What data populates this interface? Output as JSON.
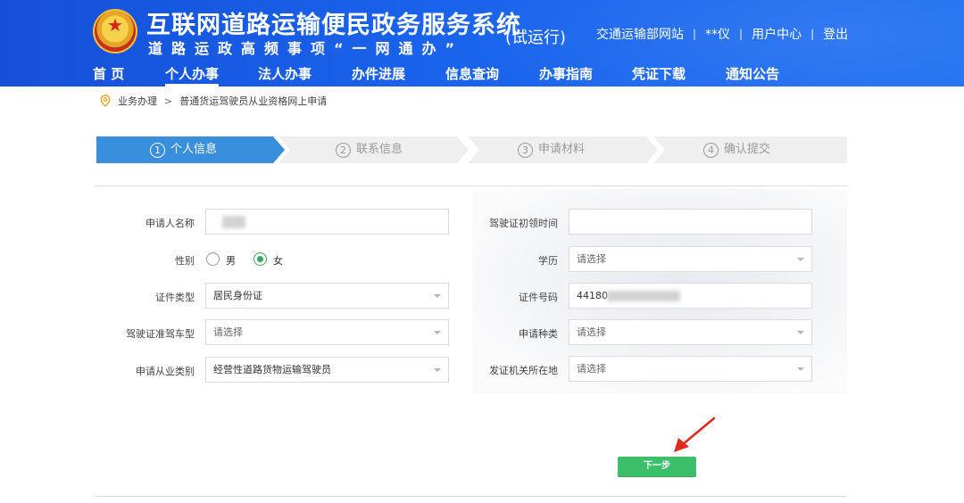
{
  "header": {
    "title": "互联网道路运输便民政务服务系统",
    "subtitle": "道路运政高频事项“一网通办”",
    "trial": "(试运行)",
    "links": [
      "交通运输部网站",
      "**仪",
      "用户中心",
      "登出"
    ],
    "separator": "|"
  },
  "nav": {
    "items": [
      "首 页",
      "个人办事",
      "法人办事",
      "办件进展",
      "信息查询",
      "办事指南",
      "凭证下载",
      "通知公告"
    ],
    "active_index": 1
  },
  "breadcrumb": {
    "items": [
      "业务办理",
      "普通货运驾驶员从业资格网上申请"
    ],
    "arrow": ">"
  },
  "steps": [
    {
      "num": "1",
      "label": "个人信息",
      "active": true
    },
    {
      "num": "2",
      "label": "联系信息",
      "active": false
    },
    {
      "num": "3",
      "label": "申请材料",
      "active": false
    },
    {
      "num": "4",
      "label": "确认提交",
      "active": false
    }
  ],
  "colors": {
    "step_active": "#3a8fdc",
    "step_inactive": "#efefef",
    "radio_on": "#38a85c",
    "button": "#3bbf6a",
    "arrow": "#e0281e"
  },
  "form": {
    "applicant_name": {
      "label": "申请人名称",
      "value": ""
    },
    "gender": {
      "label": "性别",
      "options": [
        "男",
        "女"
      ],
      "selected": "女"
    },
    "id_type": {
      "label": "证件类型",
      "value": "居民身份证"
    },
    "license_class": {
      "label": "驾驶证准驾车型",
      "placeholder": "请选择"
    },
    "occupation_type": {
      "label": "申请从业类别",
      "value": "经营性道路货物运输驾驶员"
    },
    "license_first_date": {
      "label": "驾驶证初领时间",
      "value": ""
    },
    "education": {
      "label": "学历",
      "placeholder": "请选择"
    },
    "id_number": {
      "label": "证件号码",
      "value": "44180"
    },
    "application_type": {
      "label": "申请种类",
      "placeholder": "请选择"
    },
    "issuing_authority": {
      "label": "发证机关所在地",
      "placeholder": "请选择"
    }
  },
  "next_button": {
    "label": "下一步"
  }
}
